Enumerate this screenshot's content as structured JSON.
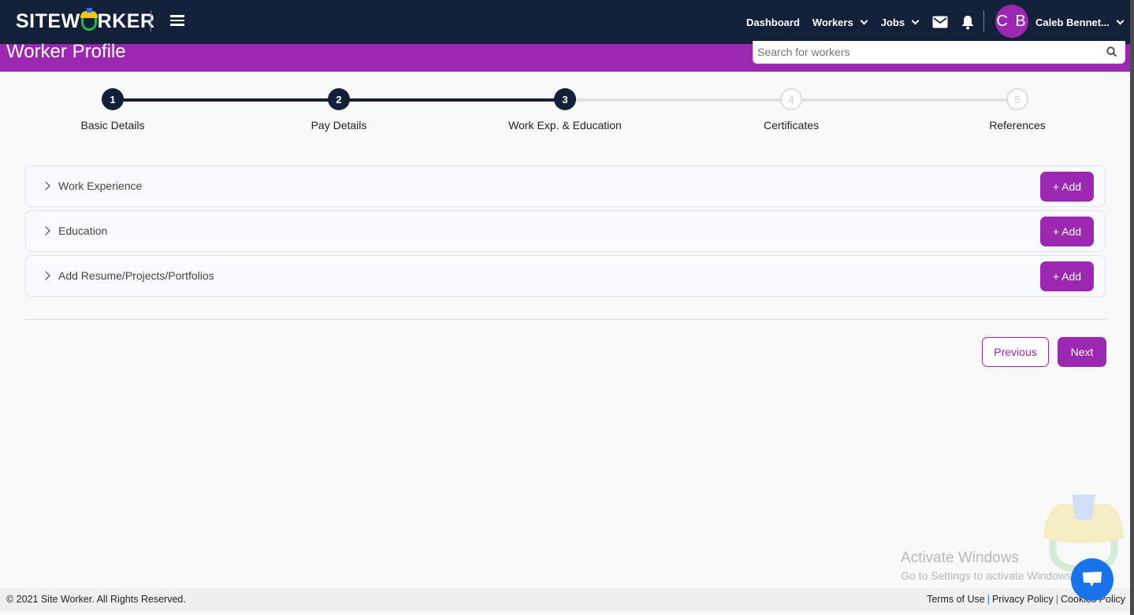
{
  "brand": {
    "logo_text_pre": "SITEW",
    "logo_text_post": "RKER"
  },
  "nav": {
    "dashboard": "Dashboard",
    "workers": "Workers",
    "jobs": "Jobs",
    "user_initials": "C B",
    "user_name": "Caleb Bennet..."
  },
  "page": {
    "title": "Worker Profile",
    "search_placeholder": "Search for workers"
  },
  "stepper": {
    "steps": [
      {
        "num": "1",
        "label": "Basic Details",
        "state": "done"
      },
      {
        "num": "2",
        "label": "Pay Details",
        "state": "done"
      },
      {
        "num": "3",
        "label": "Work Exp. & Education",
        "state": "current"
      },
      {
        "num": "4",
        "label": "Certificates",
        "state": "todo"
      },
      {
        "num": "5",
        "label": "References",
        "state": "todo"
      }
    ]
  },
  "sections": [
    {
      "label": "Work Experience",
      "button": "+ Add"
    },
    {
      "label": "Education",
      "button": "+ Add"
    },
    {
      "label": "Add Resume/Projects/Portfolios",
      "button": "+ Add"
    }
  ],
  "actions": {
    "previous": "Previous",
    "next": "Next"
  },
  "overlay": {
    "activate_title": "Activate Windows",
    "activate_sub": "Go to Settings to activate Windows."
  },
  "footer": {
    "copyright": "© 2021 Site Worker. All Rights Reserved.",
    "terms": "Terms of Use",
    "privacy": "Privacy Policy",
    "cookies": "Cookies Policy"
  },
  "colors": {
    "navbar": "#13203a",
    "accent": "#9c27b0",
    "chat": "#1a73e8"
  }
}
